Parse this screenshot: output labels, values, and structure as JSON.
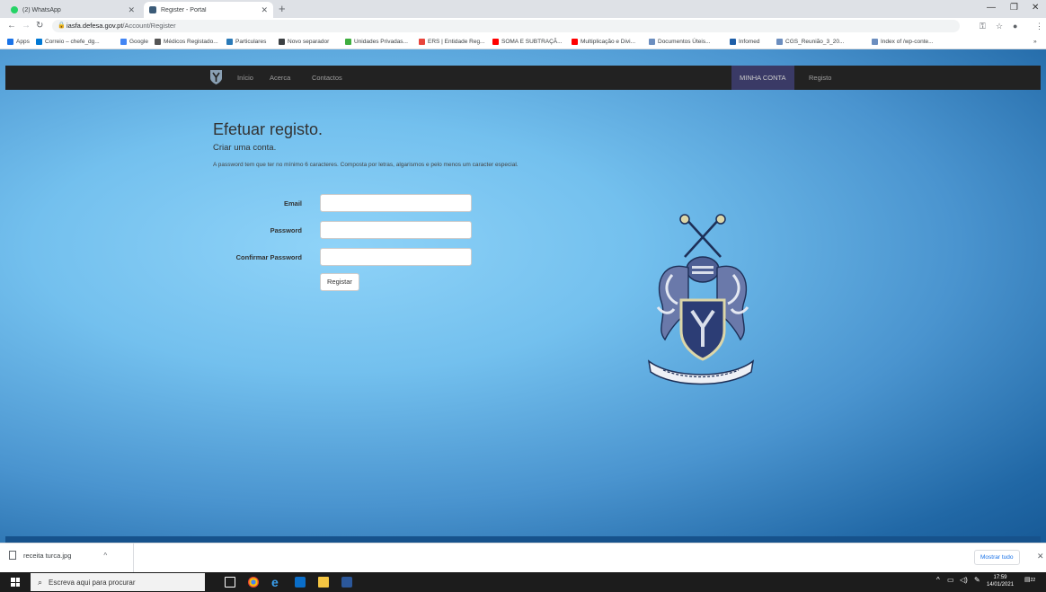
{
  "browser": {
    "tabs": [
      {
        "title": "(2) WhatsApp"
      },
      {
        "title": "Register - Portal"
      }
    ],
    "new_tab": "+",
    "url": {
      "domain": "iasfa.defesa.gov.pt",
      "path": "/Account/Register"
    },
    "bookmarks": [
      {
        "label": "Apps",
        "icon": "apps-grid-icon",
        "color": "#1a73e8"
      },
      {
        "label": "Correio – chefe_dg...",
        "icon": "outlook-icon",
        "color": "#0078d4"
      },
      {
        "label": "Google",
        "icon": "google-icon",
        "color": "#4285f4"
      },
      {
        "label": "Médicos Registado...",
        "icon": "site-icon",
        "color": "#555555"
      },
      {
        "label": "Particulares",
        "icon": "site-icon",
        "color": "#2a7ab8"
      },
      {
        "label": "Novo separador",
        "icon": "globe-icon",
        "color": "#3c4043"
      },
      {
        "label": "Unidades Privadas...",
        "icon": "check-icon",
        "color": "#3fae3f"
      },
      {
        "label": "ERS | Entidade Reg...",
        "icon": "star-icon",
        "color": "#e8453c"
      },
      {
        "label": "SOMA E SUBTRAÇÃ...",
        "icon": "youtube-icon",
        "color": "#ff0000"
      },
      {
        "label": "Multiplicação e Divi...",
        "icon": "youtube-icon",
        "color": "#ff0000"
      },
      {
        "label": "Documentos Úteis...",
        "icon": "site-icon",
        "color": "#6c8ebf"
      },
      {
        "label": "Infomed",
        "icon": "site-icon",
        "color": "#1f5fa8"
      },
      {
        "label": "CGS_Reunião_3_20...",
        "icon": "site-icon",
        "color": "#6c8ebf"
      },
      {
        "label": "Index of /wp-conte...",
        "icon": "site-icon",
        "color": "#6c8ebf"
      }
    ],
    "bookmarks_more": "»"
  },
  "site": {
    "nav": {
      "home": "Início",
      "about": "Acerca",
      "contacts": "Contactos",
      "account": "MINHA CONTA",
      "register": "Registo"
    },
    "form": {
      "title": "Efetuar registo.",
      "subtitle": "Criar uma conta.",
      "note": "A password tem que ter no mínimo 6 caracteres. Composta por letras, algarismos e pelo menos um caracter especial.",
      "email_label": "Email",
      "password_label": "Password",
      "confirm_label": "Confirmar Password",
      "email_value": "",
      "password_value": "",
      "confirm_value": "",
      "submit_label": "Registar"
    },
    "colors": {
      "navbar": "#222222",
      "accent_account": "#3a3a66",
      "background_light": "#8fd3f8",
      "background_dark": "#175a97"
    }
  },
  "downloads": {
    "file": "receita turca.jpg",
    "show_all": "Mostrar tudo"
  },
  "taskbar": {
    "search_placeholder": "Escreva aqui para procurar",
    "time": "17:59",
    "date": "14/01/2021",
    "notifications": "22"
  }
}
